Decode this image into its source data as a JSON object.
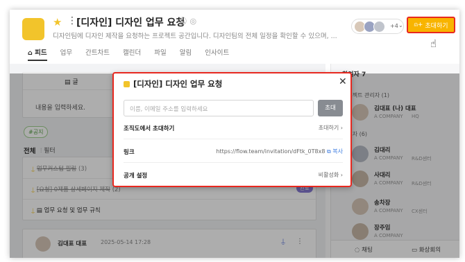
{
  "header": {
    "title": "[디자인] 디자인 업무 요청",
    "description": "디자인팀에 디자인 제작을 요청하는 프로젝트 공간입니다. 디자인팀의 전체 일정을 확인할 수 있으며, ...",
    "member_count": "+4",
    "invite_label": "초대하기",
    "tabs": [
      "피드",
      "업무",
      "간트차트",
      "캘린더",
      "파일",
      "알림",
      "인사이트"
    ]
  },
  "feed": {
    "writer_tab": "글",
    "writer_placeholder": "내용을 입력하세요.",
    "hashtag": "#공지",
    "filter_total": "전체",
    "filter_label": "필터",
    "pinned": [
      {
        "text": "업무커스텀 필링",
        "count": "(3)"
      },
      {
        "text": "[요청] 0제품 상세페이지 제작",
        "count": "(2)",
        "badge": "완료"
      },
      {
        "text": "업무 요청 및 업무 규칙",
        "count": ""
      }
    ],
    "post_author": "김대표 대표",
    "post_date": "2025-05-14 17:28"
  },
  "right_panel": {
    "header": "참여자 7",
    "admin_section": "프로젝트 관리자 (1)",
    "member_section": "참여자 (6)",
    "members": [
      {
        "name": "김대표 (나) 대표",
        "company": "A COMPANY",
        "dept": "HQ"
      },
      {
        "name": "김대리",
        "company": "A COMPANY",
        "dept": "R&D센터"
      },
      {
        "name": "사대리",
        "company": "A COMPANY",
        "dept": "R&D센터"
      },
      {
        "name": "송차장",
        "company": "A COMPANY",
        "dept": "CX센터"
      },
      {
        "name": "장주임",
        "company": "A COMPANY",
        "dept": ""
      }
    ],
    "chat_label": "채팅",
    "video_label": "화상회의"
  },
  "modal": {
    "title": "[디자인] 디자인 업무 요청",
    "input_placeholder": "이름, 이메일 주소를 입력하세요",
    "invite_button": "초대",
    "org_label": "조직도에서 초대하기",
    "org_action": "초대하기",
    "link_label": "링크",
    "link_url": "https://flow.team/invitation/dFtk_0T8x8",
    "copy_label": "복사",
    "public_label": "공개 설정",
    "public_value": "비활성화"
  },
  "colors": {
    "accent": "#f8b400",
    "highlight": "#e8281f",
    "project": "#f2c42b"
  }
}
